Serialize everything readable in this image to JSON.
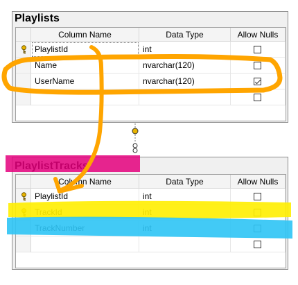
{
  "tables": [
    {
      "title": "Playlists",
      "headers": [
        "Column Name",
        "Data Type",
        "Allow Nulls"
      ],
      "rows": [
        {
          "column_name": "PlaylistId",
          "data_type": "int",
          "allow_nulls": false,
          "primary_key": true
        },
        {
          "column_name": "Name",
          "data_type": "nvarchar(120)",
          "allow_nulls": false,
          "primary_key": false
        },
        {
          "column_name": "UserName",
          "data_type": "nvarchar(120)",
          "allow_nulls": true,
          "primary_key": false
        },
        {
          "column_name": "",
          "data_type": "",
          "allow_nulls": false,
          "primary_key": false
        }
      ]
    },
    {
      "title": "PlaylistTracks",
      "headers": [
        "Column Name",
        "Data Type",
        "Allow Nulls"
      ],
      "rows": [
        {
          "column_name": "PlaylistId",
          "data_type": "int",
          "allow_nulls": false,
          "primary_key": true
        },
        {
          "column_name": "TrackId",
          "data_type": "int",
          "allow_nulls": false,
          "primary_key": true
        },
        {
          "column_name": "TrackNumber",
          "data_type": "int",
          "allow_nulls": false,
          "primary_key": false
        },
        {
          "column_name": "",
          "data_type": "",
          "allow_nulls": false,
          "primary_key": false
        }
      ]
    }
  ],
  "icons": {
    "primary_key": "key-icon",
    "relationship": "relationship-connector-icon"
  },
  "colors": {
    "annotation_orange": "#ffa500",
    "highlight_magenta": "#e4007c",
    "highlight_yellow": "#ffee00",
    "highlight_cyan": "#2ec4f5",
    "key_gold": "#e8b400"
  }
}
